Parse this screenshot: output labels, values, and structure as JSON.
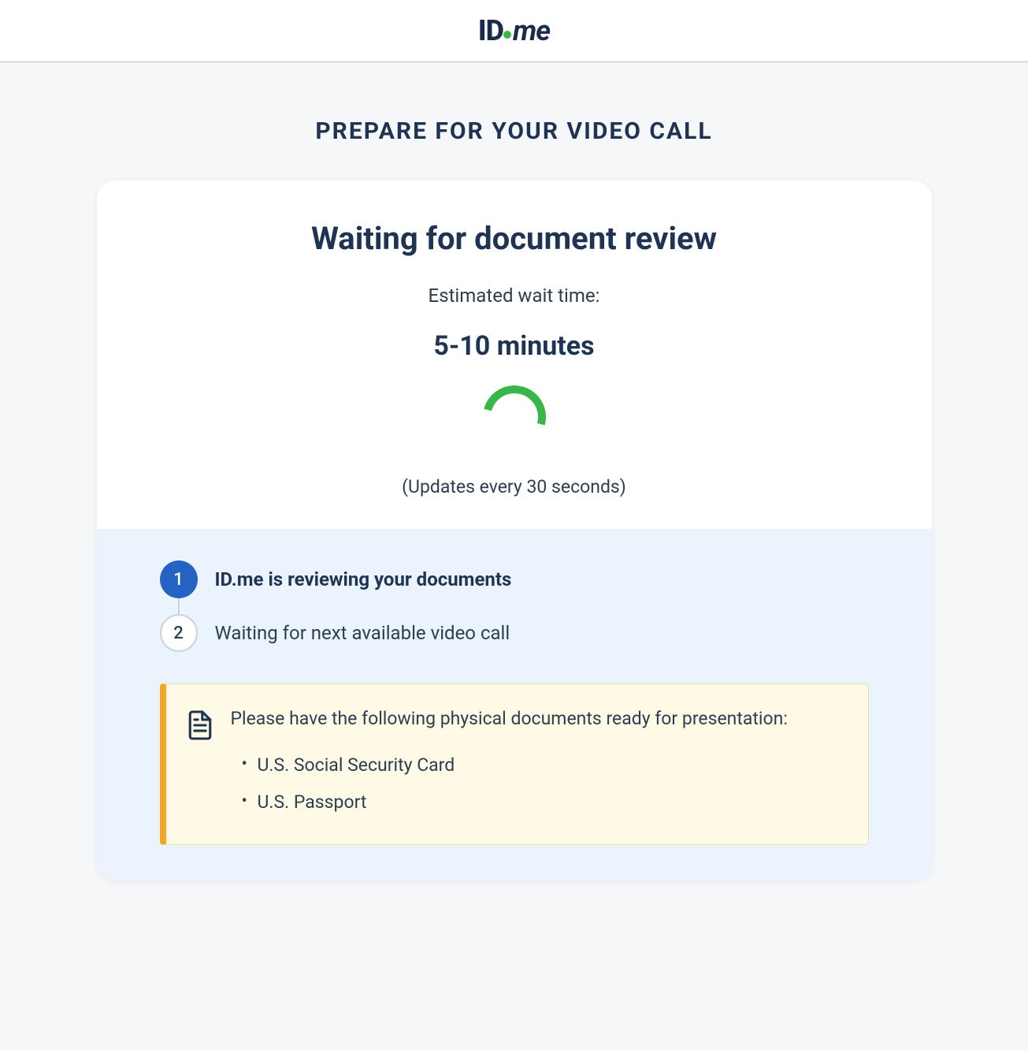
{
  "logo": {
    "part1": "ID",
    "part2": "me"
  },
  "page_title": "PREPARE FOR YOUR VIDEO CALL",
  "card": {
    "heading": "Waiting for document review",
    "wait_label": "Estimated wait time:",
    "wait_time": "5-10 minutes",
    "update_note": "(Updates every 30 seconds)"
  },
  "steps": [
    {
      "number": "1",
      "label": "ID.me is reviewing your documents",
      "state": "active"
    },
    {
      "number": "2",
      "label": "Waiting for next available video call",
      "state": "pending"
    }
  ],
  "alert": {
    "text": "Please have the following physical documents ready for presentation:",
    "items": [
      "U.S. Social Security Card",
      "U.S. Passport"
    ]
  }
}
